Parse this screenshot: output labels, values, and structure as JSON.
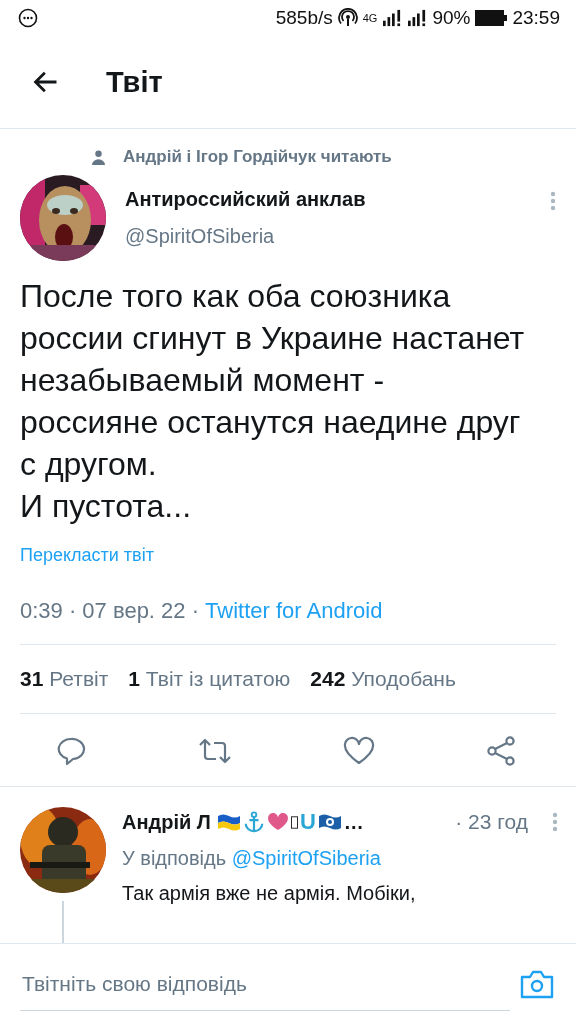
{
  "status_bar": {
    "speed": "585b/s",
    "network": "4G",
    "battery": "90%",
    "time": "23:59"
  },
  "header": {
    "title": "Твіт"
  },
  "social_context": "Андрій і Ігор Гордійчук читають",
  "tweet": {
    "author": "Антироссийский анклав",
    "handle": "@SpiritOfSiberia",
    "text": "После того как оба союзника россии сгинут в Украине настанет незабываемый момент - россияне останутся наедине друг с другом.\nИ пустота...",
    "translate": "Перекласти твіт",
    "time": "0:39 · 07 вер. 22 · ",
    "client": "Twitter for Android"
  },
  "stats": [
    {
      "count": "31",
      "label": "Ретвіт"
    },
    {
      "count": "1",
      "label": "Твіт із цитатою"
    },
    {
      "count": "242",
      "label": "Уподобань"
    }
  ],
  "reply": {
    "author": "Андрій Л",
    "badge_letter": "U",
    "overflow": "…",
    "time": "· 23 год",
    "replying_to": "У відповідь",
    "mention": "@SpiritOfSiberia",
    "text": "Так армія вже не армія. Мобіки,"
  },
  "composer": {
    "placeholder": "Твітніть свою відповідь"
  }
}
